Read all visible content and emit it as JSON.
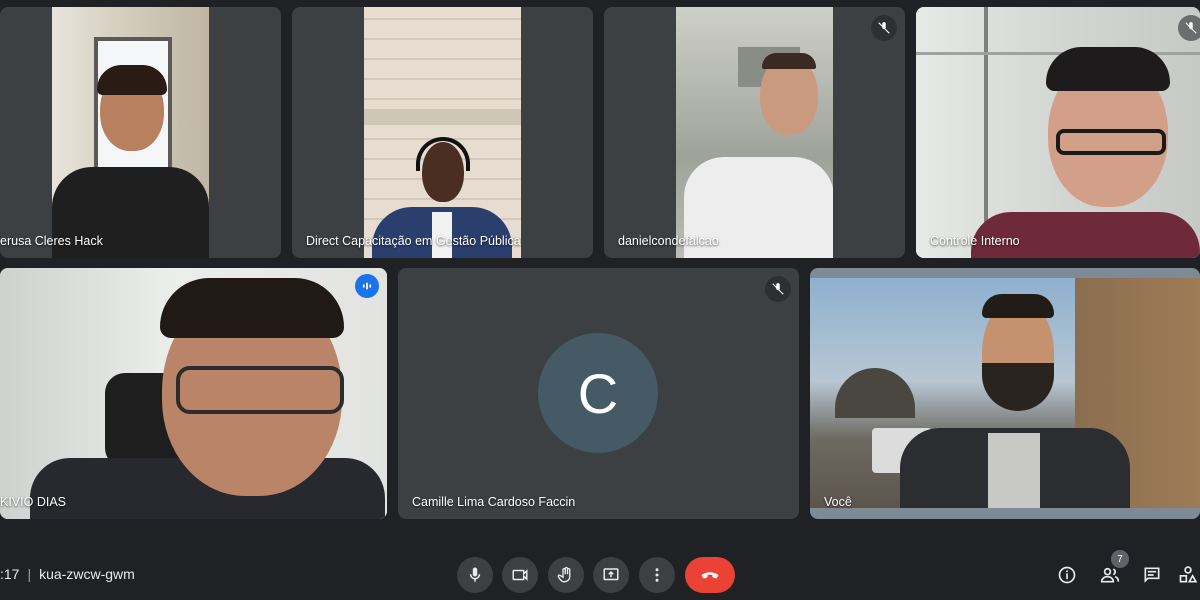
{
  "participants": [
    {
      "name": "erusa Cleres Hack"
    },
    {
      "name": "Direct Capacitação em Gestão Pública"
    },
    {
      "name": "danielcondefalcao"
    },
    {
      "name": "Controle Interno"
    },
    {
      "name": "KIVIO DIAS"
    },
    {
      "name": "Camille Lima Cardoso Faccin",
      "avatar_letter": "C"
    },
    {
      "name": "Você"
    }
  ],
  "meeting": {
    "time": ":17",
    "code": "kua-zwcw-gwm",
    "participant_count": "7"
  },
  "controls": {
    "icons": [
      "microphone-icon",
      "camera-icon",
      "raise-hand-icon",
      "present-screen-icon",
      "more-options-icon",
      "end-call-icon"
    ]
  },
  "right_controls": {
    "icons": [
      "info-icon",
      "people-icon",
      "chat-icon",
      "activities-icon"
    ]
  },
  "colors": {
    "background": "#202124",
    "tile": "#3c4043",
    "speaking_outline": "#8ab4f8",
    "end_call": "#ea4335",
    "avatar_bg": "#455a64"
  }
}
